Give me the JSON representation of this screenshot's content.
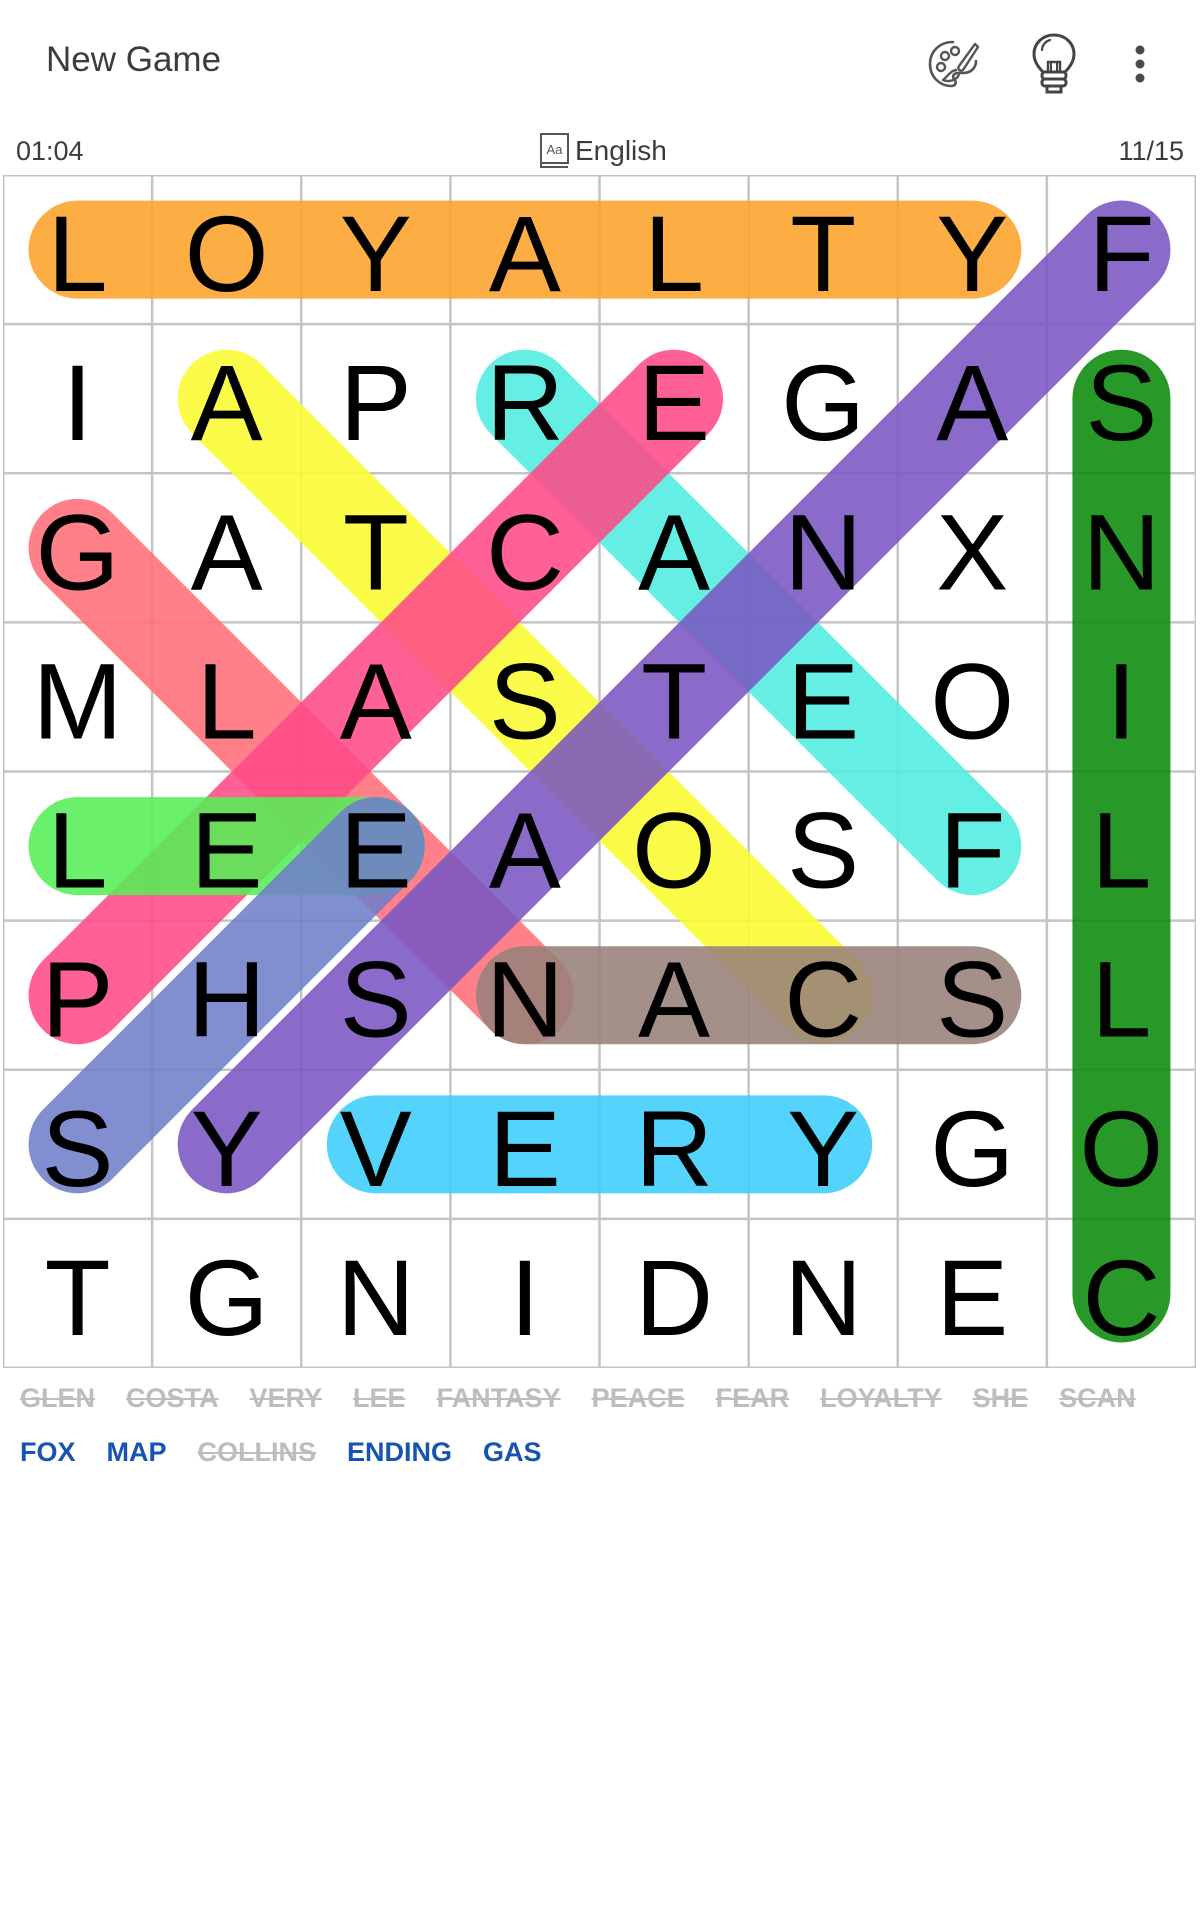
{
  "app_bar": {
    "title": "New Game",
    "icons": [
      "palette-icon",
      "lightbulb-hint-icon",
      "more-vert-icon"
    ]
  },
  "status_bar": {
    "timer": "01:04",
    "language": "English",
    "language_icon": "dictionary-icon",
    "progress": "11/15"
  },
  "board": {
    "rows": 8,
    "cols": 8,
    "letters": [
      [
        "L",
        "O",
        "Y",
        "A",
        "L",
        "T",
        "Y",
        "F"
      ],
      [
        "I",
        "A",
        "P",
        "R",
        "E",
        "G",
        "A",
        "S"
      ],
      [
        "G",
        "A",
        "T",
        "C",
        "A",
        "N",
        "X",
        "N"
      ],
      [
        "M",
        "L",
        "A",
        "S",
        "T",
        "E",
        "O",
        "I"
      ],
      [
        "L",
        "E",
        "E",
        "A",
        "O",
        "S",
        "F",
        "L"
      ],
      [
        "P",
        "H",
        "S",
        "N",
        "A",
        "C",
        "S",
        "L"
      ],
      [
        "S",
        "Y",
        "V",
        "E",
        "R",
        "Y",
        "G",
        "O"
      ],
      [
        "T",
        "G",
        "N",
        "I",
        "D",
        "N",
        "E",
        "C"
      ]
    ],
    "highlights": [
      {
        "word": "LOYALTY",
        "color": "#fca32a",
        "from": [
          0,
          0
        ],
        "to": [
          0,
          6
        ]
      },
      {
        "word": "COLLINS",
        "color": "#0a8a0a",
        "from": [
          7,
          7
        ],
        "to": [
          1,
          7
        ]
      },
      {
        "word": "COSTA",
        "color": "#fbfb30",
        "from": [
          5,
          5
        ],
        "to": [
          1,
          1
        ]
      },
      {
        "word": "FEAR",
        "color": "#50ede0",
        "from": [
          4,
          6
        ],
        "to": [
          1,
          3
        ]
      },
      {
        "word": "GLEN",
        "color": "#ff6e78",
        "from": [
          2,
          0
        ],
        "to": [
          5,
          3
        ]
      },
      {
        "word": "PEACE",
        "color": "#ff4a86",
        "from": [
          5,
          0
        ],
        "to": [
          1,
          4
        ]
      },
      {
        "word": "LEE",
        "color": "#55ee55",
        "from": [
          4,
          0
        ],
        "to": [
          4,
          2
        ]
      },
      {
        "word": "SCAN",
        "color": "#978179",
        "from": [
          5,
          6
        ],
        "to": [
          5,
          3
        ]
      },
      {
        "word": "SHE",
        "color": "#6f7ec8",
        "from": [
          6,
          0
        ],
        "to": [
          4,
          2
        ]
      },
      {
        "word": "FANTASY",
        "color": "#7a56c2",
        "from": [
          0,
          7
        ],
        "to": [
          6,
          1
        ]
      },
      {
        "word": "VERY",
        "color": "#3ccefd",
        "from": [
          6,
          2
        ],
        "to": [
          6,
          5
        ]
      }
    ]
  },
  "word_list": [
    {
      "word": "GLEN",
      "found": true
    },
    {
      "word": "COSTA",
      "found": true
    },
    {
      "word": "VERY",
      "found": true
    },
    {
      "word": "LEE",
      "found": true
    },
    {
      "word": "FANTASY",
      "found": true
    },
    {
      "word": "PEACE",
      "found": true
    },
    {
      "word": "FEAR",
      "found": true
    },
    {
      "word": "LOYALTY",
      "found": true
    },
    {
      "word": "SHE",
      "found": true
    },
    {
      "word": "SCAN",
      "found": true
    },
    {
      "word": "FOX",
      "found": false
    },
    {
      "word": "MAP",
      "found": false
    },
    {
      "word": "COLLINS",
      "found": true
    },
    {
      "word": "ENDING",
      "found": false
    },
    {
      "word": "GAS",
      "found": false
    }
  ],
  "colors": {
    "found_word": "#bdbdbd",
    "remaining_word": "#1554b0",
    "grid_line": "#c4c4c4"
  }
}
